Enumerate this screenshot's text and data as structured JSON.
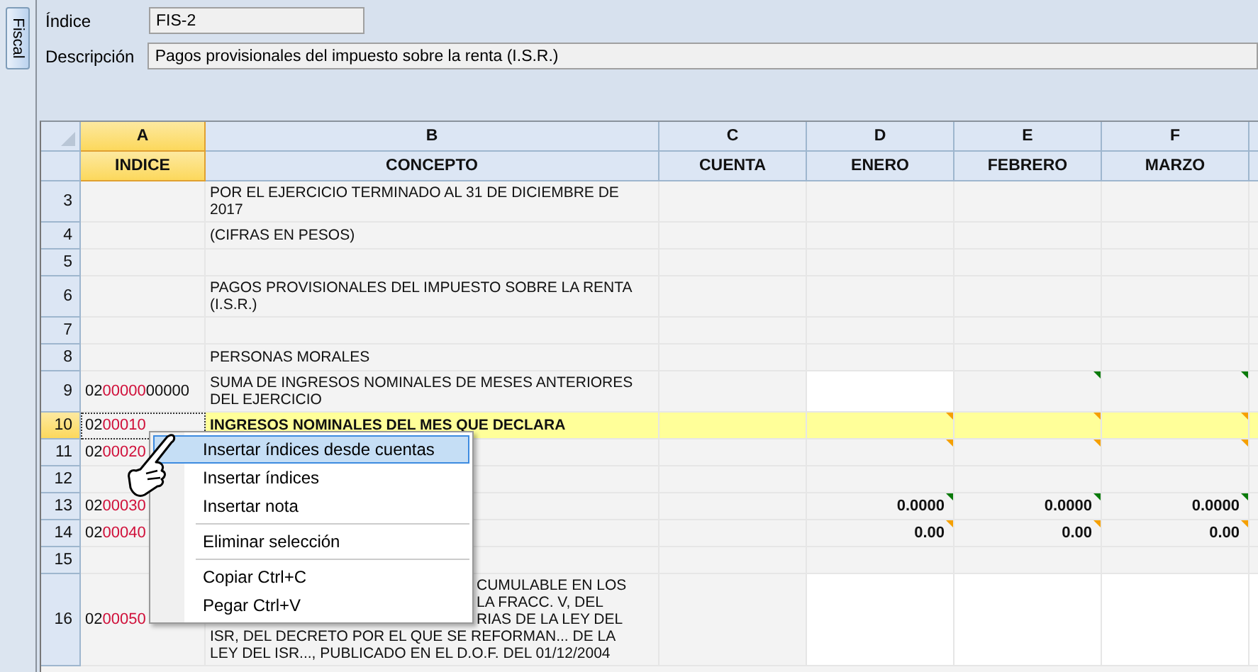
{
  "side_tab": {
    "label": "Fiscal"
  },
  "form": {
    "fields": [
      {
        "label": "Índice",
        "value": "FIS-2",
        "kind": "short"
      },
      {
        "label": "Descripción",
        "value": "Pagos provisionales del impuesto sobre la renta (I.S.R.)",
        "kind": "wide"
      }
    ]
  },
  "grid": {
    "columns": [
      {
        "letter": "A",
        "title": "INDICE",
        "selected": true
      },
      {
        "letter": "B",
        "title": "CONCEPTO",
        "selected": false
      },
      {
        "letter": "C",
        "title": "CUENTA",
        "selected": false
      },
      {
        "letter": "D",
        "title": "ENERO",
        "selected": false
      },
      {
        "letter": "E",
        "title": "FEBRERO",
        "selected": false
      },
      {
        "letter": "F",
        "title": "MARZO",
        "selected": false
      }
    ],
    "rows": [
      {
        "number": "3",
        "selected": false,
        "concept": [
          {
            "text": "POR EL EJERCICIO TERMINADO AL 31 DE DICIEMBRE DE",
            "covered": false
          },
          {
            "text": "2017",
            "covered": false
          }
        ]
      },
      {
        "number": "4",
        "selected": false,
        "concept": [
          {
            "text": "(CIFRAS EN PESOS)",
            "covered": false
          }
        ]
      },
      {
        "number": "5",
        "selected": false
      },
      {
        "number": "6",
        "selected": false,
        "concept": [
          {
            "text": "PAGOS PROVISIONALES DEL IMPUESTO SOBRE LA RENTA",
            "covered": false
          },
          {
            "text": "(I.S.R.)",
            "covered": false
          }
        ]
      },
      {
        "number": "7",
        "selected": false
      },
      {
        "number": "8",
        "selected": false,
        "concept": [
          {
            "text": "PERSONAS MORALES",
            "covered": false
          }
        ]
      },
      {
        "number": "9",
        "selected": false,
        "index": {
          "prefix": "02",
          "code": "00000",
          "suffix": "00000"
        },
        "concept": [
          {
            "text": "SUMA DE INGRESOS NOMINALES DE MESES ANTERIORES",
            "covered": false
          },
          {
            "text": "DEL EJERCICIO",
            "covered": false
          }
        ],
        "months": [
          {
            "editable": true
          },
          {
            "editable": false,
            "color": "#0a7a0a"
          },
          {
            "editable": false,
            "color": "#0a7a0a"
          }
        ]
      },
      {
        "number": "10",
        "selected": true,
        "index": {
          "prefix": "02",
          "code": "00010"
        },
        "concept": [
          {
            "text": "INGRESOS NOMINALES DEL MES QUE DECLARA",
            "covered": false
          }
        ],
        "months": [
          {
            "editable": false,
            "color": "#f5a000"
          },
          {
            "editable": false,
            "color": "#f5a000"
          },
          {
            "editable": false,
            "color": "#f5a000"
          }
        ]
      },
      {
        "number": "11",
        "selected": false,
        "index": {
          "prefix": "02",
          "code": "00020"
        },
        "months": [
          {
            "editable": false,
            "color": "#f5a000"
          },
          {
            "editable": false,
            "color": "#f5a000"
          },
          {
            "editable": false,
            "color": "#f5a000"
          }
        ]
      },
      {
        "number": "12",
        "selected": false
      },
      {
        "number": "13",
        "selected": false,
        "index": {
          "prefix": "02",
          "code": "00030"
        },
        "months": [
          {
            "value": "0.0000",
            "editable": false,
            "color": "#0a7a0a"
          },
          {
            "value": "0.0000",
            "editable": false,
            "color": "#0a7a0a"
          },
          {
            "value": "0.0000",
            "editable": false,
            "color": "#0a7a0a"
          }
        ]
      },
      {
        "number": "14",
        "selected": false,
        "index": {
          "prefix": "02",
          "code": "00040"
        },
        "months": [
          {
            "value": "0.00",
            "editable": false,
            "color": "#f5a000"
          },
          {
            "value": "0.00",
            "editable": false,
            "color": "#f5a000"
          },
          {
            "value": "0.00",
            "editable": false,
            "color": "#f5a000"
          }
        ]
      },
      {
        "number": "15",
        "selected": false
      },
      {
        "number": "16",
        "selected": false,
        "index": {
          "prefix": "02",
          "code": "00050"
        },
        "concept": [
          {
            "text": "CUMULABLE EN LOS",
            "covered": true
          },
          {
            "text": "LA FRACC. V, DEL",
            "covered": true
          },
          {
            "text": "RIAS DE LA LEY DEL",
            "covered": true
          },
          {
            "text": "ISR, DEL DECRETO POR EL QUE SE REFORMAN... DE LA",
            "covered": false
          },
          {
            "text": "LEY DEL ISR..., PUBLICADO EN EL D.O.F. DEL 01/12/2004",
            "covered": false
          }
        ],
        "months": [
          {
            "editable": true
          },
          {
            "editable": true
          },
          {
            "editable": true
          }
        ]
      }
    ]
  },
  "context_menu": {
    "items": [
      {
        "kind": "item",
        "label": "Insertar índices desde cuentas",
        "selected": true
      },
      {
        "kind": "item",
        "label": "Insertar índices",
        "selected": false
      },
      {
        "kind": "item",
        "label": "Insertar nota",
        "selected": false
      },
      {
        "kind": "separator"
      },
      {
        "kind": "item",
        "label": "Eliminar selección",
        "selected": false
      },
      {
        "kind": "separator"
      },
      {
        "kind": "item",
        "label": "Copiar Ctrl+C",
        "selected": false
      },
      {
        "kind": "item",
        "label": "Pegar Ctrl+V",
        "selected": false
      }
    ]
  }
}
